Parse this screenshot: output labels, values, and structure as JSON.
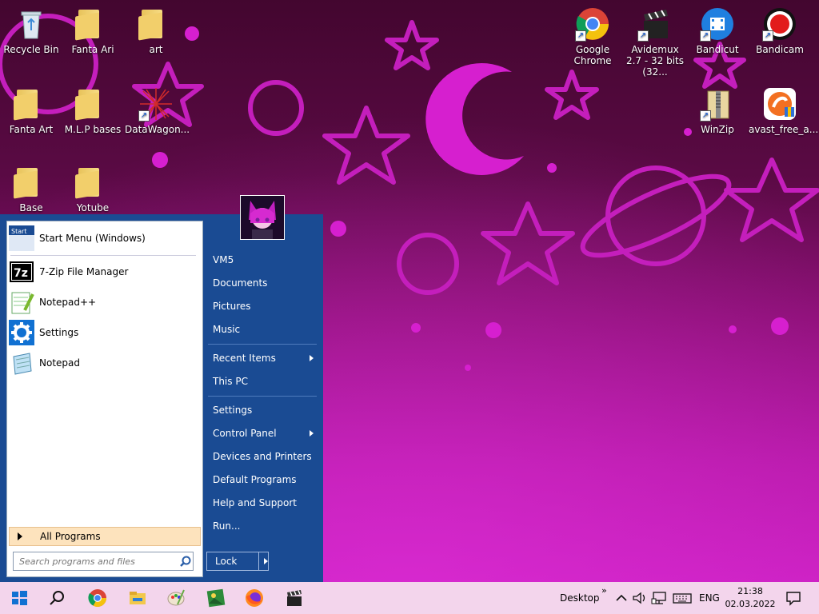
{
  "desktop_icons": [
    {
      "label": "Recycle Bin",
      "icon": "recycle-bin-icon"
    },
    {
      "label": "Fanta Ari",
      "icon": "folder-icon"
    },
    {
      "label": "art",
      "icon": "folder-icon"
    },
    {
      "label": "Fanta Art",
      "icon": "folder-icon"
    },
    {
      "label": "M.L.P bases",
      "icon": "folder-icon"
    },
    {
      "label": "DataWagon...",
      "icon": "datawagon-icon"
    },
    {
      "label": "Base",
      "icon": "folder-icon"
    },
    {
      "label": "Yotube",
      "icon": "folder-icon"
    },
    {
      "label": "Google Chrome",
      "icon": "chrome-icon"
    },
    {
      "label": "Avidemux 2.7 - 32 bits (32...",
      "icon": "clapperboard-icon"
    },
    {
      "label": "Bandicut",
      "icon": "bandicut-icon"
    },
    {
      "label": "Bandicam",
      "icon": "bandicam-icon"
    },
    {
      "label": "WinZip",
      "icon": "winzip-icon"
    },
    {
      "label": "avast_free_a...",
      "icon": "avast-icon"
    }
  ],
  "start_menu": {
    "pinned": [
      {
        "label": "Start Menu (Windows)",
        "icon": "start-menu-icon"
      },
      {
        "label": "7-Zip File Manager",
        "icon": "7zip-icon"
      },
      {
        "label": "Notepad++",
        "icon": "notepadpp-icon"
      },
      {
        "label": "Settings",
        "icon": "gear-icon"
      },
      {
        "label": "Notepad",
        "icon": "notepad-icon"
      }
    ],
    "all_programs": "All Programs",
    "search_placeholder": "Search programs and files",
    "right_items": [
      "VM5",
      "Documents",
      "Pictures",
      "Music",
      "Recent Items",
      "This PC",
      "Settings",
      "Control Panel",
      "Devices and Printers",
      "Default Programs",
      "Help and Support",
      "Run..."
    ],
    "lock_label": "Lock"
  },
  "taskbar": {
    "desktop_label": "Desktop",
    "language": "ENG",
    "time": "21:38",
    "date": "02.03.2022"
  },
  "colors": {
    "start_menu_bg": "#1a4b93",
    "taskbar_bg": "#f3d5ec",
    "all_programs_bg": "#fde3bd",
    "wallpaper_accent": "#d61fcf"
  }
}
